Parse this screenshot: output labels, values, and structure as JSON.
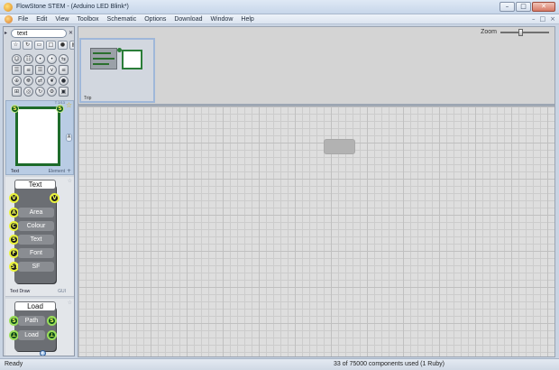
{
  "window": {
    "title": "FlowStone STEM - (Arduino LED Blink*)",
    "controls": [
      "–",
      "□",
      "✕"
    ]
  },
  "menubar": {
    "items": [
      "File",
      "Edit",
      "View",
      "Toolbox",
      "Schematic",
      "Options",
      "Download",
      "Window",
      "Help"
    ],
    "right_controls": [
      "–",
      "□",
      "×"
    ]
  },
  "toolbox": {
    "search": {
      "value": "text",
      "placeholder": ""
    },
    "arrow_icon": "triangle-right-icon",
    "clear_icon": "x-icon",
    "filter_buttons": [
      {
        "icon": "star-icon",
        "glyph": "☆"
      },
      {
        "icon": "refresh-icon",
        "glyph": "↻"
      },
      {
        "icon": "modules-icon",
        "glyph": "▭"
      },
      {
        "icon": "primitives-icon",
        "glyph": "□"
      },
      {
        "icon": "ruby-icon",
        "glyph": "●"
      },
      {
        "icon": "trash-icon",
        "glyph": "▤"
      }
    ],
    "filter_glyphs": [
      "☆",
      "↻",
      "▭",
      "□",
      "●",
      "▤"
    ],
    "grid_glyphs": [
      "☺",
      "☷",
      "•",
      "•",
      "⇆",
      "☰",
      "≡",
      "☰",
      "∨",
      "≡",
      "⊕",
      "☸",
      "⇄",
      "❦",
      "●",
      "⊞",
      "◎",
      "↻",
      "⚙",
      "▣"
    ],
    "preview": {
      "name": "Text",
      "group": "Element",
      "star": "☆",
      "side_letter": "A",
      "plus": "+",
      "corner_text": "T 2/13",
      "node_glyph": "S"
    },
    "text_card": {
      "title": "Text",
      "top_pins": [
        "V",
        "V"
      ],
      "inputs": [
        {
          "pin": "A",
          "label": "Area"
        },
        {
          "pin": "C",
          "label": "Colour"
        },
        {
          "pin": "S",
          "label": "Text"
        },
        {
          "pin": "F",
          "label": "Font"
        },
        {
          "pin": "ST",
          "label": "SF"
        }
      ],
      "footer_name": "Text Draw",
      "footer_group": "GUI",
      "star": "☆"
    },
    "load_card": {
      "title": "Load",
      "rows": [
        {
          "pin_in": "S",
          "label": "Path",
          "pin_out": "S"
        },
        {
          "pin_in": "⊥",
          "label": "Load",
          "pin_out": "⊥"
        }
      ],
      "star": "☆"
    }
  },
  "navigator": {
    "zoom_label": "Zoom",
    "zoom_level": 0.4,
    "trip_label": "Trip"
  },
  "statusbar": {
    "left": "Ready",
    "right": "33 of 75000 components used (1 Ruby)"
  },
  "colors": {
    "accent_green": "#1d6b2a",
    "pin_yellow": "#e9f23c",
    "selection_blue": "#b9cce4"
  }
}
